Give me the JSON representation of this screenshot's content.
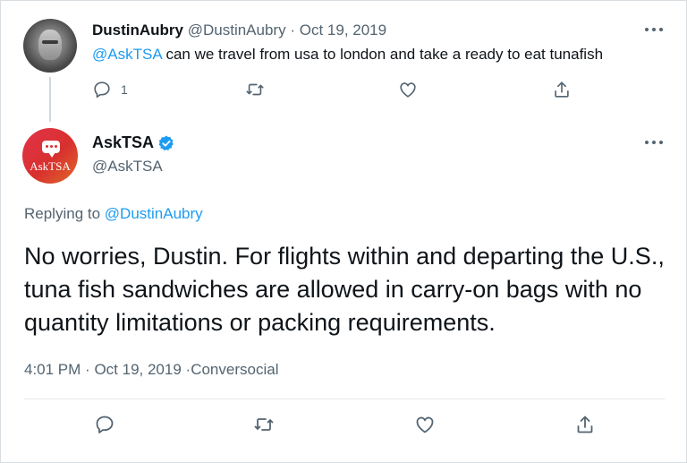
{
  "tweet1": {
    "display_name": "DustinAubry",
    "handle": "@DustinAubry",
    "separator": "·",
    "date": "Oct 19, 2019",
    "mention": "@AskTSA",
    "text": " can we travel from usa to london and take a ready to eat tunafish",
    "reply_count": "1",
    "more_icon": "more-dots-icon"
  },
  "tweet2": {
    "display_name": "AskTSA",
    "handle": "@AskTSA",
    "avatar_text": "AskTSA",
    "verified": true,
    "replying_prefix": "Replying to ",
    "replying_to": "@DustinAubry",
    "text": "No worries, Dustin. For flights within and departing the U.S., tuna fish sandwiches are allowed in carry-on bags with no quantity limitations or packing requirements.",
    "time": "4:01 PM",
    "separator": "·",
    "date": "Oct 19, 2019",
    "source": "Conversocial"
  },
  "colors": {
    "link": "#1d9bf0",
    "muted": "#536471",
    "verified_badge": "#1d9bf0",
    "asktsa_avatar": "#d8302e"
  },
  "icons": {
    "reply": "reply-icon",
    "retweet": "retweet-icon",
    "like": "heart-icon",
    "share": "share-icon",
    "verified": "verified-badge-icon"
  }
}
